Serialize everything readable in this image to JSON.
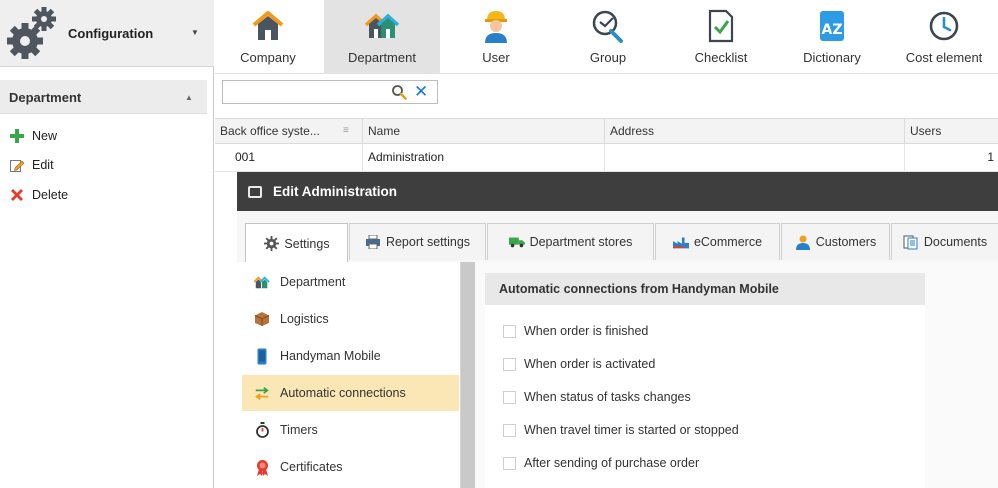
{
  "config": {
    "title": "Configuration"
  },
  "toolbar": {
    "buttons": [
      {
        "label": "Company",
        "icon": "house-icon"
      },
      {
        "label": "Department",
        "icon": "department-houses-icon",
        "active": true
      },
      {
        "label": "User",
        "icon": "worker-icon"
      },
      {
        "label": "Group",
        "icon": "group-tools-icon"
      },
      {
        "label": "Checklist",
        "icon": "checklist-icon"
      },
      {
        "label": "Dictionary",
        "icon": "dictionary-icon",
        "badge": "AZ"
      },
      {
        "label": "Cost element",
        "icon": "clock-icon"
      }
    ]
  },
  "sidebar": {
    "title": "Department",
    "actions": [
      {
        "label": "New",
        "icon": "plus-icon"
      },
      {
        "label": "Edit",
        "icon": "edit-icon"
      },
      {
        "label": "Delete",
        "icon": "delete-x-icon"
      }
    ]
  },
  "search": {
    "value": "",
    "placeholder": ""
  },
  "grid": {
    "columns": [
      "Back office syste...",
      "Name",
      "Address",
      "Users"
    ],
    "rows": [
      {
        "code": "001",
        "name": "Administration",
        "address": "",
        "users": "1"
      }
    ]
  },
  "dialog": {
    "title": "Edit Administration",
    "tabs": [
      {
        "label": "Settings",
        "icon": "gear-icon",
        "active": true
      },
      {
        "label": "Report settings",
        "icon": "printer-icon"
      },
      {
        "label": "Department stores",
        "icon": "truck-icon"
      },
      {
        "label": "eCommerce",
        "icon": "factory-icon"
      },
      {
        "label": "Customers",
        "icon": "person-icon"
      },
      {
        "label": "Documents",
        "icon": "documents-icon"
      }
    ],
    "side_items": [
      {
        "label": "Department",
        "icon": "department-houses-icon"
      },
      {
        "label": "Logistics",
        "icon": "box-icon"
      },
      {
        "label": "Handyman Mobile",
        "icon": "phone-icon"
      },
      {
        "label": "Automatic connections",
        "icon": "arrows-exchange-icon",
        "selected": true
      },
      {
        "label": "Timers",
        "icon": "stopwatch-icon"
      },
      {
        "label": "Certificates",
        "icon": "certificate-icon"
      }
    ],
    "panel": {
      "title": "Automatic connections from Handyman Mobile",
      "options": [
        {
          "label": "When order is finished",
          "checked": false
        },
        {
          "label": "When order is activated",
          "checked": false
        },
        {
          "label": "When status of tasks changes",
          "checked": false
        },
        {
          "label": "When travel timer is started or stopped",
          "checked": false
        },
        {
          "label": "After sending of purchase order",
          "checked": false
        }
      ]
    }
  },
  "colors": {
    "toolbar_active_bg": "#e3e3e3",
    "dialog_title_bg": "#3e3e3e",
    "selected_item_bg": "#fbe6b5",
    "accent_blue": "#1b78d0",
    "green": "#3aa64a",
    "red": "#e53b2c"
  }
}
